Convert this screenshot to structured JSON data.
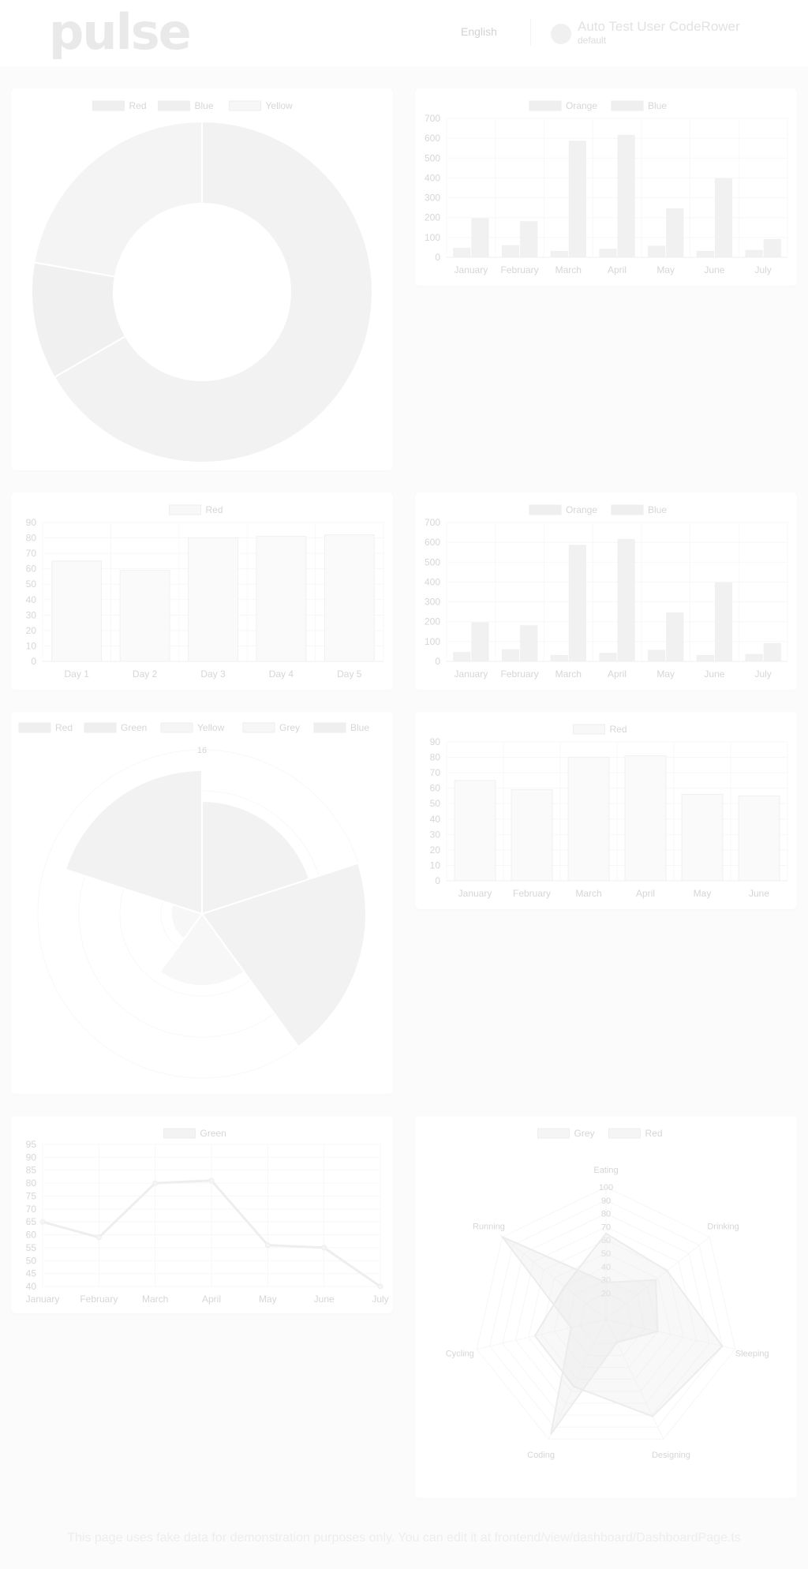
{
  "header": {
    "logo": "pulse",
    "language": "English",
    "user_name": "Auto Test User CodeRower",
    "user_subtitle": "default"
  },
  "footer": {
    "note": "This page uses fake data for demonstration purposes only. You can edit it at frontend/view/dashboard/DashboardPage.ts"
  },
  "chart_data": [
    {
      "type": "doughnut",
      "legend": [
        "Red",
        "Blue",
        "Yellow"
      ],
      "legend_colors": [
        "#efefef",
        "#efefef",
        "#f7f7f7"
      ],
      "values": [
        300,
        50,
        100
      ],
      "slice_colors": [
        "#f2f2f2",
        "#f0f0f0",
        "#f4f4f4"
      ]
    },
    {
      "type": "bar",
      "legend": [
        "Orange",
        "Blue"
      ],
      "legend_colors": [
        "#efefef",
        "#efefef"
      ],
      "categories": [
        "January",
        "February",
        "March",
        "April",
        "May",
        "June",
        "July"
      ],
      "series": [
        {
          "name": "Orange",
          "values": [
            45,
            59,
            30,
            41,
            56,
            30,
            35
          ]
        },
        {
          "name": "Blue",
          "values": [
            195,
            180,
            585,
            615,
            245,
            395,
            90
          ]
        }
      ],
      "ylim": [
        0,
        700
      ],
      "yticks": [
        0,
        100,
        200,
        300,
        400,
        500,
        600,
        700
      ]
    },
    {
      "type": "bar",
      "legend": [
        "Red"
      ],
      "legend_colors": [
        "#f8f8f8"
      ],
      "categories": [
        "Day 1",
        "Day 2",
        "Day 3",
        "Day 4",
        "Day 5"
      ],
      "series": [
        {
          "name": "Red",
          "values": [
            65,
            59,
            80,
            81,
            82
          ]
        }
      ],
      "ylim": [
        0,
        90
      ],
      "yticks": [
        0,
        10,
        20,
        30,
        40,
        50,
        60,
        70,
        80,
        90
      ]
    },
    {
      "type": "bar",
      "legend": [
        "Orange",
        "Blue"
      ],
      "legend_colors": [
        "#efefef",
        "#efefef"
      ],
      "categories": [
        "January",
        "February",
        "March",
        "April",
        "May",
        "June",
        "July"
      ],
      "series": [
        {
          "name": "Orange",
          "values": [
            45,
            59,
            30,
            41,
            56,
            30,
            35
          ]
        },
        {
          "name": "Blue",
          "values": [
            195,
            180,
            585,
            615,
            245,
            395,
            90
          ]
        }
      ],
      "ylim": [
        0,
        700
      ],
      "yticks": [
        0,
        100,
        200,
        300,
        400,
        500,
        600,
        700
      ]
    },
    {
      "type": "polarArea",
      "legend": [
        "Red",
        "Green",
        "Yellow",
        "Grey",
        "Blue"
      ],
      "legend_colors": [
        "#efefef",
        "#efefef",
        "#f5f5f5",
        "#f7f7f7",
        "#efefef"
      ],
      "values": [
        11,
        16,
        7,
        3,
        14
      ],
      "rmax": 16,
      "rticks": [
        16
      ]
    },
    {
      "type": "bar",
      "legend": [
        "Red"
      ],
      "legend_colors": [
        "#f8f8f8"
      ],
      "categories": [
        "January",
        "February",
        "March",
        "April",
        "May",
        "June"
      ],
      "series": [
        {
          "name": "Red",
          "values": [
            65,
            59,
            80,
            81,
            56,
            55
          ]
        }
      ],
      "ylim": [
        0,
        90
      ],
      "yticks": [
        0,
        10,
        20,
        30,
        40,
        50,
        60,
        70,
        80,
        90
      ]
    },
    {
      "type": "line",
      "legend": [
        "Green"
      ],
      "legend_colors": [
        "#f3f3f3"
      ],
      "categories": [
        "January",
        "February",
        "March",
        "April",
        "May",
        "June",
        "July"
      ],
      "series": [
        {
          "name": "Green",
          "values": [
            65,
            59,
            80,
            81,
            56,
            55,
            40
          ]
        }
      ],
      "ylim": [
        40,
        95
      ],
      "yticks": [
        40,
        45,
        50,
        55,
        60,
        65,
        70,
        75,
        80,
        85,
        90,
        95
      ]
    },
    {
      "type": "radar",
      "legend": [
        "Grey",
        "Red"
      ],
      "legend_colors": [
        "#f5f5f5",
        "#f5f5f5"
      ],
      "labels": [
        "Eating",
        "Drinking",
        "Sleeping",
        "Designing",
        "Coding",
        "Cycling",
        "Running"
      ],
      "series": [
        {
          "name": "Grey",
          "values": [
            65,
            59,
            90,
            81,
            56,
            55,
            40
          ]
        },
        {
          "name": "Red",
          "values": [
            28,
            48,
            40,
            19,
            96,
            27,
            100
          ]
        }
      ],
      "rmax": 100,
      "rticks": [
        20,
        30,
        40,
        50,
        60,
        70,
        80,
        90,
        100
      ]
    }
  ]
}
